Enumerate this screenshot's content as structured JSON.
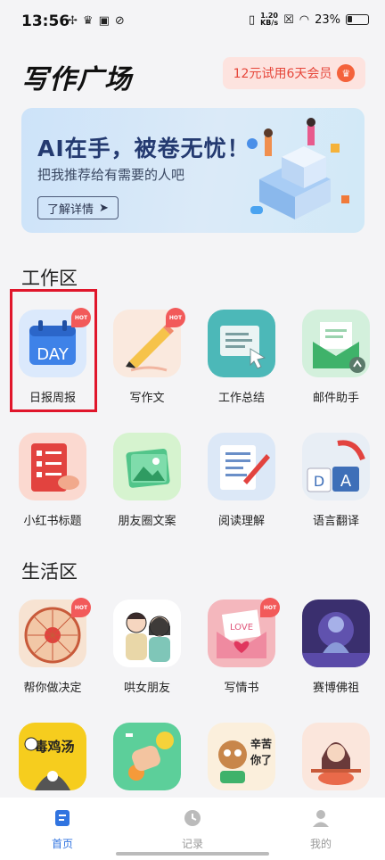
{
  "status": {
    "time": "13:56",
    "speed_top": "1.20",
    "speed_unit": "KB/s",
    "battery": "23%"
  },
  "header": {
    "title": "写作广场",
    "vip_label": "12元试用6天会员"
  },
  "banner": {
    "headline": "AI在手，被卷无忧！",
    "subtitle": "把我推荐给有需要的人吧",
    "button": "了解详情"
  },
  "work": {
    "title": "工作区",
    "items": [
      {
        "label": "日报周报",
        "icon": "day-calendar-icon",
        "hot": "HOT"
      },
      {
        "label": "写作文",
        "icon": "pencil-icon",
        "hot": "HOT"
      },
      {
        "label": "工作总结",
        "icon": "monitor-cursor-icon"
      },
      {
        "label": "邮件助手",
        "icon": "mail-envelope-icon"
      },
      {
        "label": "小红书标题",
        "icon": "phone-list-icon"
      },
      {
        "label": "朋友圈文案",
        "icon": "photo-icon"
      },
      {
        "label": "阅读理解",
        "icon": "document-pen-icon"
      },
      {
        "label": "语言翻译",
        "icon": "translate-icon"
      }
    ]
  },
  "life": {
    "title": "生活区",
    "items": [
      {
        "label": "帮你做决定",
        "icon": "spin-wheel-icon",
        "hot": "HOT"
      },
      {
        "label": "哄女朋友",
        "icon": "couple-icon"
      },
      {
        "label": "写情书",
        "icon": "love-letter-icon",
        "hot": "HOT"
      },
      {
        "label": "赛博佛祖",
        "icon": "cyber-buddha-icon"
      },
      {
        "label": "",
        "icon": "poison-soup-icon",
        "text": "毒鸡汤"
      },
      {
        "label": "",
        "icon": "thumbs-up-icon"
      },
      {
        "label": "",
        "icon": "tired-raccoon-icon",
        "text": "辛苦你了"
      },
      {
        "label": "",
        "icon": "noodle-girl-icon"
      }
    ]
  },
  "tabs": [
    {
      "label": "首页",
      "icon": "home-doc-icon",
      "active": true
    },
    {
      "label": "记录",
      "icon": "clock-icon"
    },
    {
      "label": "我的",
      "icon": "user-icon"
    }
  ],
  "colors": {
    "accent": "#3174e0",
    "vip_text": "#e6463a",
    "highlight": "#e0162b"
  }
}
